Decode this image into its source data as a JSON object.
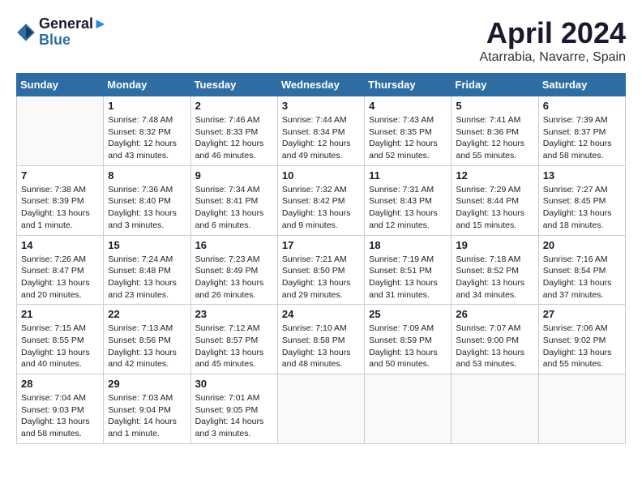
{
  "header": {
    "logo_line1": "General",
    "logo_line2": "Blue",
    "month_year": "April 2024",
    "location": "Atarrabia, Navarre, Spain"
  },
  "days_of_week": [
    "Sunday",
    "Monday",
    "Tuesday",
    "Wednesday",
    "Thursday",
    "Friday",
    "Saturday"
  ],
  "weeks": [
    [
      {
        "day": "",
        "text": ""
      },
      {
        "day": "1",
        "text": "Sunrise: 7:48 AM\nSunset: 8:32 PM\nDaylight: 12 hours\nand 43 minutes."
      },
      {
        "day": "2",
        "text": "Sunrise: 7:46 AM\nSunset: 8:33 PM\nDaylight: 12 hours\nand 46 minutes."
      },
      {
        "day": "3",
        "text": "Sunrise: 7:44 AM\nSunset: 8:34 PM\nDaylight: 12 hours\nand 49 minutes."
      },
      {
        "day": "4",
        "text": "Sunrise: 7:43 AM\nSunset: 8:35 PM\nDaylight: 12 hours\nand 52 minutes."
      },
      {
        "day": "5",
        "text": "Sunrise: 7:41 AM\nSunset: 8:36 PM\nDaylight: 12 hours\nand 55 minutes."
      },
      {
        "day": "6",
        "text": "Sunrise: 7:39 AM\nSunset: 8:37 PM\nDaylight: 12 hours\nand 58 minutes."
      }
    ],
    [
      {
        "day": "7",
        "text": "Sunrise: 7:38 AM\nSunset: 8:39 PM\nDaylight: 13 hours\nand 1 minute."
      },
      {
        "day": "8",
        "text": "Sunrise: 7:36 AM\nSunset: 8:40 PM\nDaylight: 13 hours\nand 3 minutes."
      },
      {
        "day": "9",
        "text": "Sunrise: 7:34 AM\nSunset: 8:41 PM\nDaylight: 13 hours\nand 6 minutes."
      },
      {
        "day": "10",
        "text": "Sunrise: 7:32 AM\nSunset: 8:42 PM\nDaylight: 13 hours\nand 9 minutes."
      },
      {
        "day": "11",
        "text": "Sunrise: 7:31 AM\nSunset: 8:43 PM\nDaylight: 13 hours\nand 12 minutes."
      },
      {
        "day": "12",
        "text": "Sunrise: 7:29 AM\nSunset: 8:44 PM\nDaylight: 13 hours\nand 15 minutes."
      },
      {
        "day": "13",
        "text": "Sunrise: 7:27 AM\nSunset: 8:45 PM\nDaylight: 13 hours\nand 18 minutes."
      }
    ],
    [
      {
        "day": "14",
        "text": "Sunrise: 7:26 AM\nSunset: 8:47 PM\nDaylight: 13 hours\nand 20 minutes."
      },
      {
        "day": "15",
        "text": "Sunrise: 7:24 AM\nSunset: 8:48 PM\nDaylight: 13 hours\nand 23 minutes."
      },
      {
        "day": "16",
        "text": "Sunrise: 7:23 AM\nSunset: 8:49 PM\nDaylight: 13 hours\nand 26 minutes."
      },
      {
        "day": "17",
        "text": "Sunrise: 7:21 AM\nSunset: 8:50 PM\nDaylight: 13 hours\nand 29 minutes."
      },
      {
        "day": "18",
        "text": "Sunrise: 7:19 AM\nSunset: 8:51 PM\nDaylight: 13 hours\nand 31 minutes."
      },
      {
        "day": "19",
        "text": "Sunrise: 7:18 AM\nSunset: 8:52 PM\nDaylight: 13 hours\nand 34 minutes."
      },
      {
        "day": "20",
        "text": "Sunrise: 7:16 AM\nSunset: 8:54 PM\nDaylight: 13 hours\nand 37 minutes."
      }
    ],
    [
      {
        "day": "21",
        "text": "Sunrise: 7:15 AM\nSunset: 8:55 PM\nDaylight: 13 hours\nand 40 minutes."
      },
      {
        "day": "22",
        "text": "Sunrise: 7:13 AM\nSunset: 8:56 PM\nDaylight: 13 hours\nand 42 minutes."
      },
      {
        "day": "23",
        "text": "Sunrise: 7:12 AM\nSunset: 8:57 PM\nDaylight: 13 hours\nand 45 minutes."
      },
      {
        "day": "24",
        "text": "Sunrise: 7:10 AM\nSunset: 8:58 PM\nDaylight: 13 hours\nand 48 minutes."
      },
      {
        "day": "25",
        "text": "Sunrise: 7:09 AM\nSunset: 8:59 PM\nDaylight: 13 hours\nand 50 minutes."
      },
      {
        "day": "26",
        "text": "Sunrise: 7:07 AM\nSunset: 9:00 PM\nDaylight: 13 hours\nand 53 minutes."
      },
      {
        "day": "27",
        "text": "Sunrise: 7:06 AM\nSunset: 9:02 PM\nDaylight: 13 hours\nand 55 minutes."
      }
    ],
    [
      {
        "day": "28",
        "text": "Sunrise: 7:04 AM\nSunset: 9:03 PM\nDaylight: 13 hours\nand 58 minutes."
      },
      {
        "day": "29",
        "text": "Sunrise: 7:03 AM\nSunset: 9:04 PM\nDaylight: 14 hours\nand 1 minute."
      },
      {
        "day": "30",
        "text": "Sunrise: 7:01 AM\nSunset: 9:05 PM\nDaylight: 14 hours\nand 3 minutes."
      },
      {
        "day": "",
        "text": ""
      },
      {
        "day": "",
        "text": ""
      },
      {
        "day": "",
        "text": ""
      },
      {
        "day": "",
        "text": ""
      }
    ]
  ]
}
